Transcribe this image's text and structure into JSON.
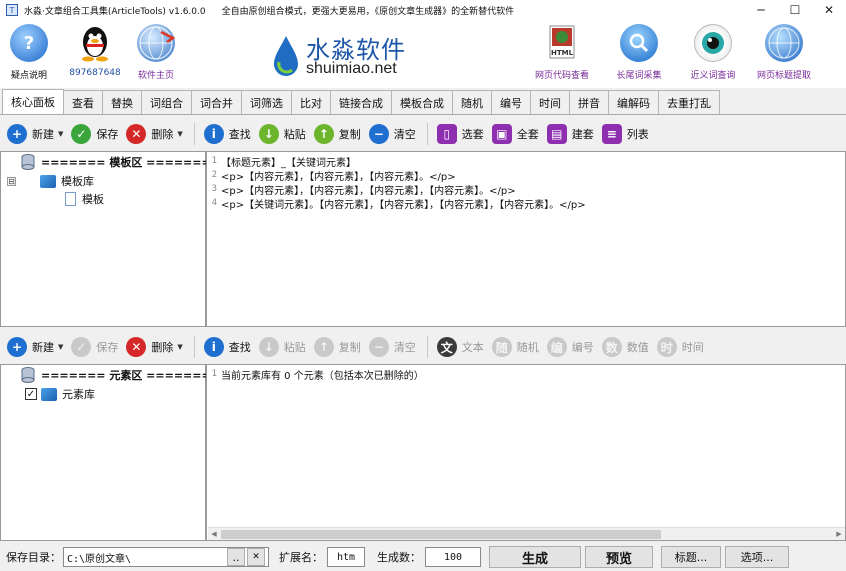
{
  "window": {
    "title": "水淼·文章组合工具集(ArticleTools) v1.6.0.0",
    "slogan": "全自由原创组合模式，更强大更易用，《原创文章生成器》的全新替代软件",
    "minimize": "─",
    "maximize": "☐",
    "close": "✕"
  },
  "banner": {
    "left_items": [
      {
        "label": "疑点说明",
        "icon": "help-icon",
        "glyph": "?"
      },
      {
        "label": "897687648",
        "icon": "qq-penguin-icon",
        "glyph": ""
      },
      {
        "label": "软件主页",
        "icon": "globe-home-icon",
        "glyph": ""
      }
    ],
    "logo_cn": "水淼软件",
    "logo_en": "shuimiao.net",
    "right_items": [
      {
        "label": "网页代码查看",
        "icon": "html-file-icon",
        "glyph": "HTML"
      },
      {
        "label": "长尾词采集",
        "icon": "search-icon",
        "glyph": ""
      },
      {
        "label": "近义词查询",
        "icon": "eye-icon",
        "glyph": ""
      },
      {
        "label": "网页标题提取",
        "icon": "globe-extract-icon",
        "glyph": ""
      }
    ]
  },
  "tabs": [
    "核心面板",
    "查看",
    "替换",
    "词组合",
    "词合并",
    "词筛选",
    "比对",
    "链接合成",
    "模板合成",
    "随机",
    "编号",
    "时间",
    "拼音",
    "编解码",
    "去重打乱"
  ],
  "active_tab": 0,
  "toolbar1": {
    "new": "新建",
    "save": "保存",
    "delete": "删除",
    "find": "查找",
    "paste": "粘贴",
    "copy": "复制",
    "clear": "清空",
    "select_set": "选套",
    "all_set": "全套",
    "build_set": "建套",
    "list": "列表"
  },
  "template_tree": {
    "root": "======= 模板区 =======",
    "expander": "⊟",
    "lib": "模板库",
    "item": "模板"
  },
  "template_editor": {
    "lines": [
      {
        "n": "1",
        "text": "【标题元素】_【关键词元素】"
      },
      {
        "n": "2",
        "text": "<p>【内容元素】，【内容元素】，【内容元素】。</p>"
      },
      {
        "n": "3",
        "text": "<p>【内容元素】，【内容元素】，【内容元素】，【内容元素】。</p>"
      },
      {
        "n": "4",
        "text": "<p>【关键词元素】。【内容元素】，【内容元素】，【内容元素】，【内容元素】。</p>"
      }
    ]
  },
  "toolbar2": {
    "new": "新建",
    "save": "保存",
    "delete": "删除",
    "find": "查找",
    "paste": "粘贴",
    "copy": "复制",
    "clear": "清空",
    "text": "文本",
    "random": "随机",
    "number": "编号",
    "value": "数值",
    "time": "时间"
  },
  "element_tree": {
    "root": "======= 元素区 =======",
    "check": "✓",
    "lib": "元素库"
  },
  "element_editor": {
    "lines": [
      {
        "n": "1",
        "text": "当前元素库有 0 个元素（包括本次已删除的）"
      }
    ]
  },
  "bottom": {
    "save_dir_label": "保存目录：",
    "save_dir": "C:\\原创文章\\",
    "browse": "..",
    "clear_x": "✕",
    "ext_label": "扩展名：",
    "ext": "htm",
    "count_label": "生成数：",
    "count": "100",
    "generate": "生成",
    "preview": "预览",
    "title_btn": "标题...",
    "options_btn": "选项..."
  },
  "colors": {
    "accent_blue": "#1f6fd1",
    "green": "#3aa53a",
    "red": "#d62828",
    "purple": "#7a2a9a"
  }
}
